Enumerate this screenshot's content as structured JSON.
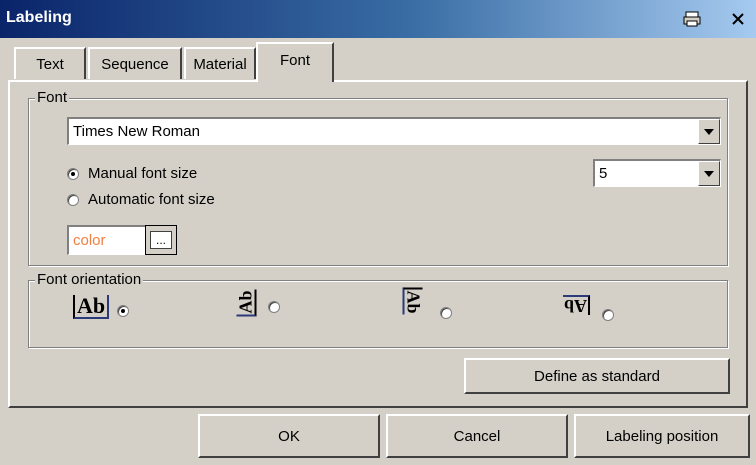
{
  "window": {
    "title": "Labeling"
  },
  "tabs": [
    {
      "label": "Text"
    },
    {
      "label": "Sequence"
    },
    {
      "label": "Material"
    },
    {
      "label": "Font"
    }
  ],
  "font_group": {
    "label": "Font",
    "font_name": "Times New Roman",
    "manual_label": "Manual font size",
    "automatic_label": "Automatic font size",
    "selected": "manual",
    "size_value": "5",
    "color_value": "color",
    "color_text": "#f08040",
    "browse_label": "..."
  },
  "orientation_group": {
    "label": "Font orientation",
    "options": [
      {
        "icon": "Ab",
        "selected": true
      },
      {
        "icon": "Ab",
        "selected": false
      },
      {
        "icon": "Ab",
        "selected": false
      },
      {
        "icon": "Ab",
        "selected": false
      }
    ]
  },
  "buttons": {
    "define_standard": "Define as standard",
    "ok": "OK",
    "cancel": "Cancel",
    "labeling_position": "Labeling position"
  }
}
